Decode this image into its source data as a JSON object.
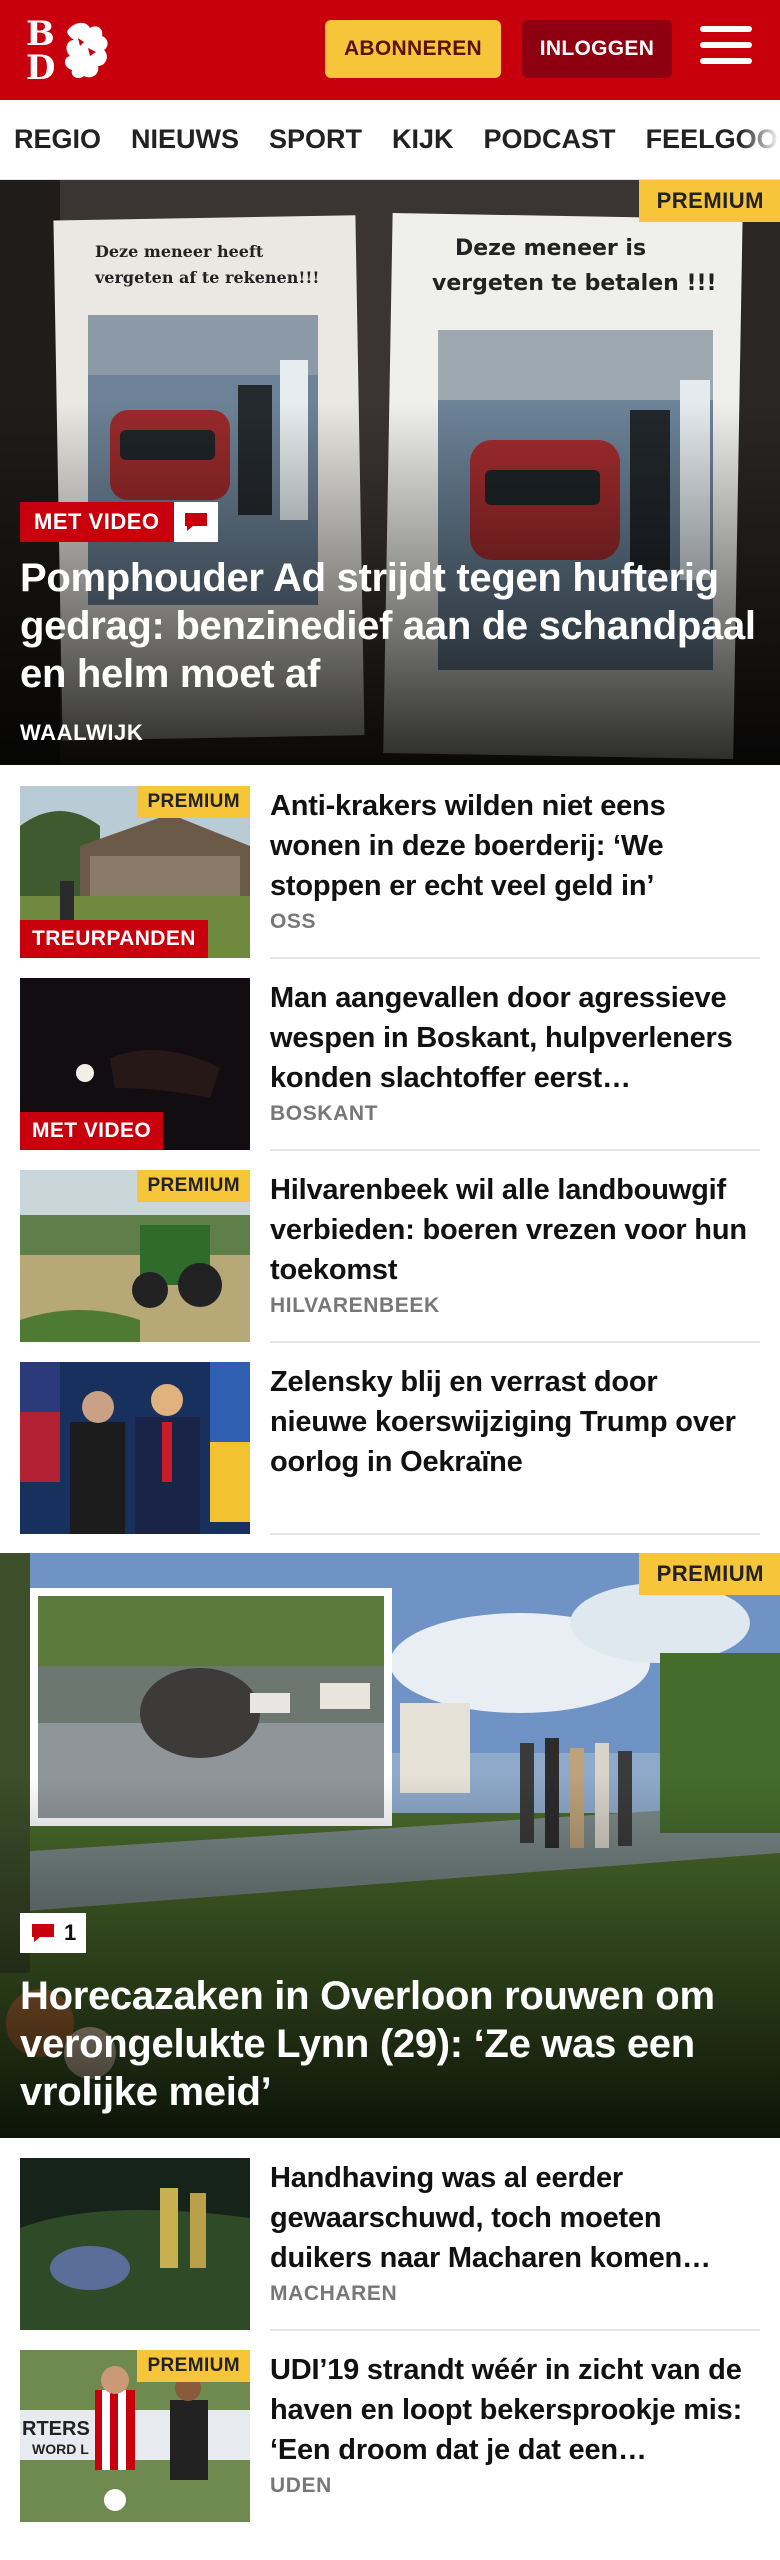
{
  "header": {
    "logo_text_top": "B",
    "logo_text_bottom": "D",
    "subscribe_label": "ABONNEREN",
    "login_label": "INLOGGEN",
    "brand_color": "#c8000e",
    "subscribe_color": "#f6c53a"
  },
  "nav": {
    "items": [
      "REGIO",
      "NIEUWS",
      "SPORT",
      "KIJK",
      "PODCAST",
      "FEELGOOD"
    ]
  },
  "hero1": {
    "premium": "PREMIUM",
    "badge": "MET VIDEO",
    "badge_icon": "comment-icon",
    "title": "Pomphouder Ad strijdt tegen hufterig gedrag: benzinedief aan de schandpaal en helm moet af",
    "location": "WAALWIJK",
    "sign_left": "Deze meneer heeft vergeten af te rekenen!!!",
    "sign_right": "Deze meneer is vergeten te betalen !!!"
  },
  "articles1": [
    {
      "premium": "PREMIUM",
      "badge": "TREURPANDEN",
      "title": "Anti-krakers wilden niet eens wonen in deze boerderij: ‘We stoppen er echt veel geld in’",
      "location": "OSS"
    },
    {
      "premium": "",
      "badge": "MET VIDEO",
      "title": "Man aangevallen door agressieve wespen in Boskant, hulpverle­ners konden slachtoffer eerst…",
      "location": "BOSKANT"
    },
    {
      "premium": "PREMIUM",
      "badge": "",
      "title": "Hilvarenbeek wil alle landbouw­gif verbieden: boeren vrezen voor hun toekomst",
      "location": "HILVARENBEEK"
    },
    {
      "premium": "",
      "badge": "",
      "title": "Zelensky blij en verrast door nieuwe koerswijziging Trump over oorlog in Oekraïne",
      "location": ""
    }
  ],
  "hero2": {
    "premium": "PREMIUM",
    "comment_count": "1",
    "title": "Horecazaken in Overloon rouwen om verongelukte Lynn (29): ‘Ze was een vrolijke meid’"
  },
  "articles2": [
    {
      "premium": "",
      "title": "Handhaving was al eerder gewaarschuwd, toch moeten duikers naar Macharen komen…",
      "location": "MACHAREN"
    },
    {
      "premium": "PREMIUM",
      "title": "UDI’19 strandt wéér in zicht van de haven en loopt bekersprookje mis: ‘Een droom dat je dat een…",
      "location": "UDEN",
      "banner_text": "RTERS CL",
      "banner_text2": "WORD L"
    }
  ]
}
